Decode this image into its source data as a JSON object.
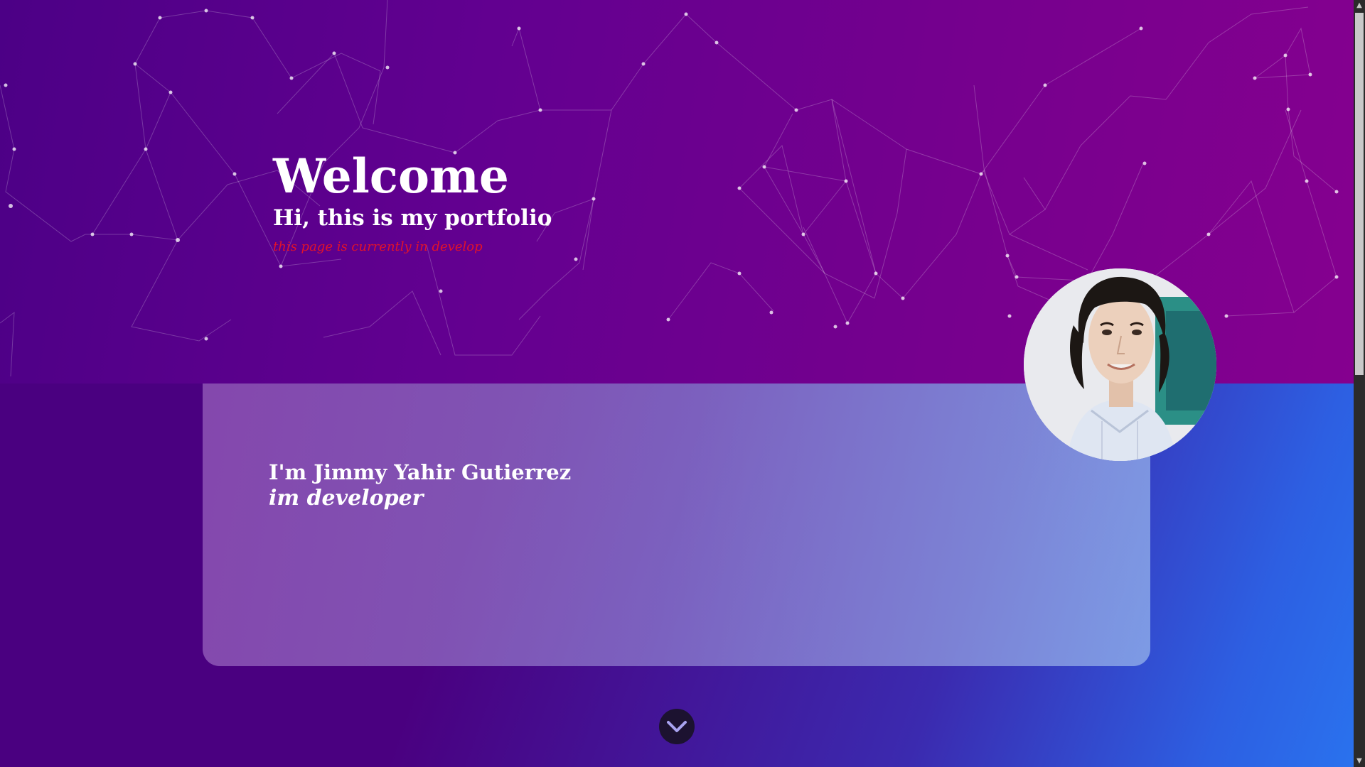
{
  "hero": {
    "title": "Welcome",
    "subtitle": "Hi, this is my portfolio",
    "notice": "this page is currently in develop"
  },
  "card": {
    "name": "I'm Jimmy Yahir Gutierrez",
    "role": "im developer"
  },
  "icons": {
    "avatar": "profile-photo",
    "scroll_down": "chevron-down-icon",
    "scroll_up_arrow": "triangle-up-icon",
    "scroll_down_arrow": "triangle-down-icon"
  },
  "scrollbar": {
    "up_glyph": "▲",
    "down_glyph": "▼"
  },
  "colors": {
    "hero_start": "#4c0086",
    "hero_end": "#85008f",
    "bottom_start": "#4a0080",
    "bottom_end": "#2a72ee",
    "notice": "#e2122a",
    "text": "#ffffff"
  }
}
